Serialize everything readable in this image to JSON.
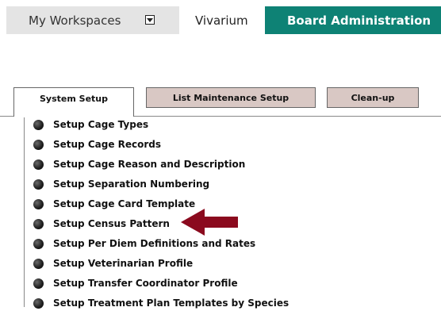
{
  "topnav": {
    "workspaces_label": "My Workspaces",
    "vivarium_label": "Vivarium",
    "board_label": "Board Administration",
    "board_color": "#0e8275"
  },
  "tabs": [
    {
      "label": "System Setup",
      "active": true
    },
    {
      "label": "List Maintenance Setup",
      "active": false
    },
    {
      "label": "Clean-up",
      "active": false
    }
  ],
  "list": {
    "items": [
      "Setup Cage Types",
      "Setup Cage Records",
      "Setup Cage Reason and Description",
      "Setup Separation Numbering",
      "Setup Cage Card Template",
      "Setup Census Pattern",
      "Setup Per Diem Definitions and Rates",
      "Setup Veterinarian Profile",
      "Setup Transfer Coordinator Profile",
      "Setup Treatment Plan Templates by Species"
    ],
    "highlighted_item": "Setup Census Pattern"
  },
  "annotation": {
    "arrow_color": "#8b0a1e",
    "icon": "left-arrow-icon"
  }
}
